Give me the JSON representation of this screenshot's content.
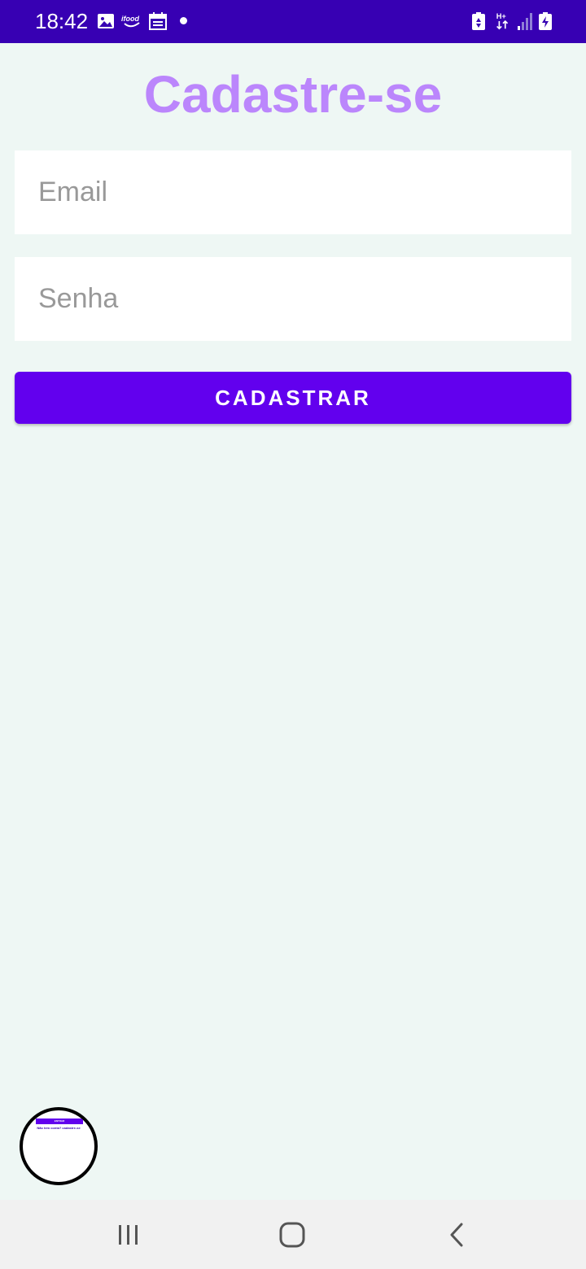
{
  "status_bar": {
    "time": "18:42",
    "icons": [
      "image-icon",
      "ifood-icon",
      "calendar-icon",
      "notification-dot-icon",
      "battery-saver-icon",
      "network-h-plus-icon",
      "signal-icon",
      "battery-charging-icon"
    ],
    "network_label": "H+"
  },
  "screen": {
    "title": "Cadastre-se"
  },
  "form": {
    "email_placeholder": "Email",
    "email_value": "",
    "password_placeholder": "Senha",
    "password_value": "",
    "submit_label": "CADASTRAR"
  },
  "floating_thumbnail": {
    "bar_label": "ENTRAR",
    "text": "Não tem conta? cadastre-se"
  },
  "nav_bar": {
    "icons": [
      "recent-apps-icon",
      "home-icon",
      "back-icon"
    ]
  },
  "colors": {
    "status_bar": "#3700B3",
    "background": "#EEF7F4",
    "title": "#BB86FC",
    "button": "#6200EE",
    "nav_bar": "#F1F1F1"
  }
}
